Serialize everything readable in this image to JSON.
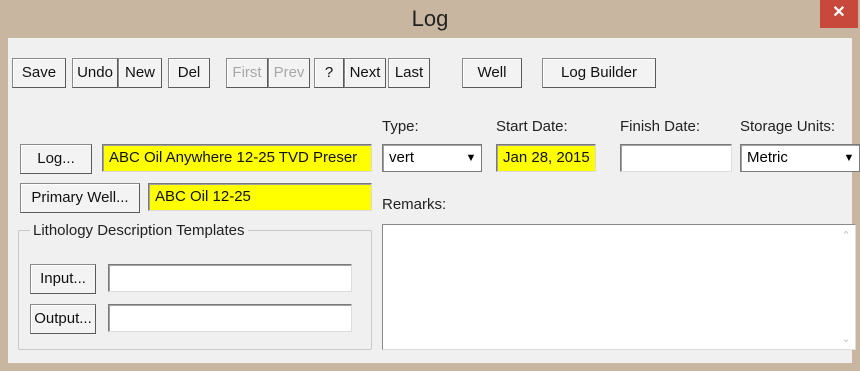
{
  "window": {
    "title": "Log",
    "close_glyph": "✕"
  },
  "toolbar": {
    "save": "Save",
    "undo": "Undo",
    "new": "New",
    "del": "Del",
    "first": "First",
    "prev": "Prev",
    "help": "?",
    "next": "Next",
    "last": "Last",
    "well": "Well",
    "log_builder": "Log Builder"
  },
  "form": {
    "log_button": "Log...",
    "log_value": "ABC Oil Anywhere 12-25 TVD Preser",
    "primary_well_button": "Primary Well...",
    "primary_well_value": "ABC Oil 12-25",
    "type_label": "Type:",
    "type_value": "vert",
    "start_date_label": "Start Date:",
    "start_date_value": "Jan 28, 2015",
    "finish_date_label": "Finish Date:",
    "finish_date_value": "",
    "storage_units_label": "Storage Units:",
    "storage_units_value": "Metric",
    "remarks_label": "Remarks:",
    "remarks_value": ""
  },
  "lithology": {
    "group_label": "Lithology Description Templates",
    "input_button": "Input...",
    "input_value": "",
    "output_button": "Output...",
    "output_value": ""
  },
  "colors": {
    "highlight": "#ffff00",
    "frame": "#c9b6a0",
    "close": "#c8483c"
  }
}
